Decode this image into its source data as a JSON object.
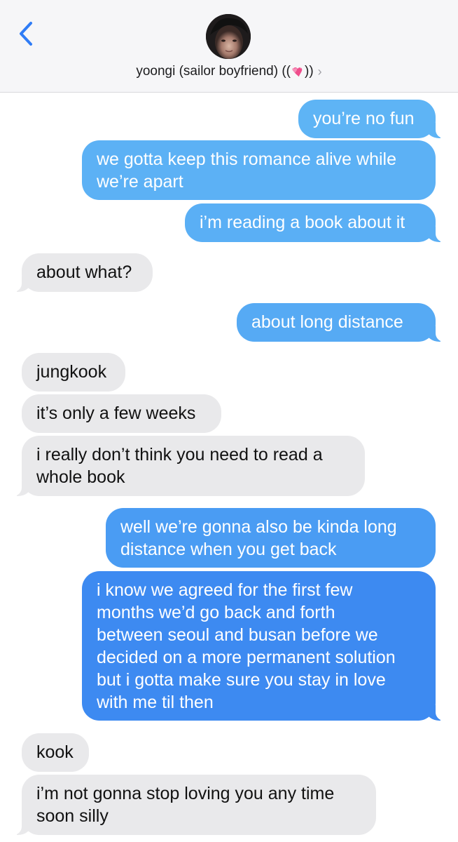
{
  "header": {
    "contact_name": "yoongi (sailor boyfriend) ((",
    "contact_name_suffix": "))",
    "contact_emoji": "two-hearts-icon",
    "back_icon": "chevron-left-icon",
    "disclosure_icon": "chevron-right-icon"
  },
  "colors": {
    "sent_top": "#5db3f5",
    "sent_bottom": "#3b87f0",
    "received": "#e9e9eb",
    "accent": "#2f7cf6"
  },
  "messages": [
    {
      "from": "me",
      "text": "you’re no fun"
    },
    {
      "from": "me",
      "line1": "we gotta keep this romance alive while",
      "line2": "we’re apart"
    },
    {
      "from": "me",
      "text": "i’m reading a book about it"
    },
    {
      "from": "them",
      "text": "about what?"
    },
    {
      "from": "me",
      "text": "about long distance"
    },
    {
      "from": "them",
      "text": "jungkook"
    },
    {
      "from": "them",
      "text": "it’s only a few weeks"
    },
    {
      "from": "them",
      "line1": "i really don’t think you need to read a",
      "line2": "whole book"
    },
    {
      "from": "me",
      "line1": "well we’re gonna also be kinda long",
      "line2": "distance when you get back"
    },
    {
      "from": "me",
      "line1": "i know we agreed for the first few",
      "line2": "months we’d go back and forth",
      "line3": "between seoul and busan before we",
      "line4": "decided on a more permanent solution",
      "line5": "but i gotta make sure you stay in love",
      "line6": "with me til then"
    },
    {
      "from": "them",
      "text": "kook"
    },
    {
      "from": "them",
      "line1": "i’m not gonna stop loving you any time",
      "line2": "soon silly"
    }
  ]
}
